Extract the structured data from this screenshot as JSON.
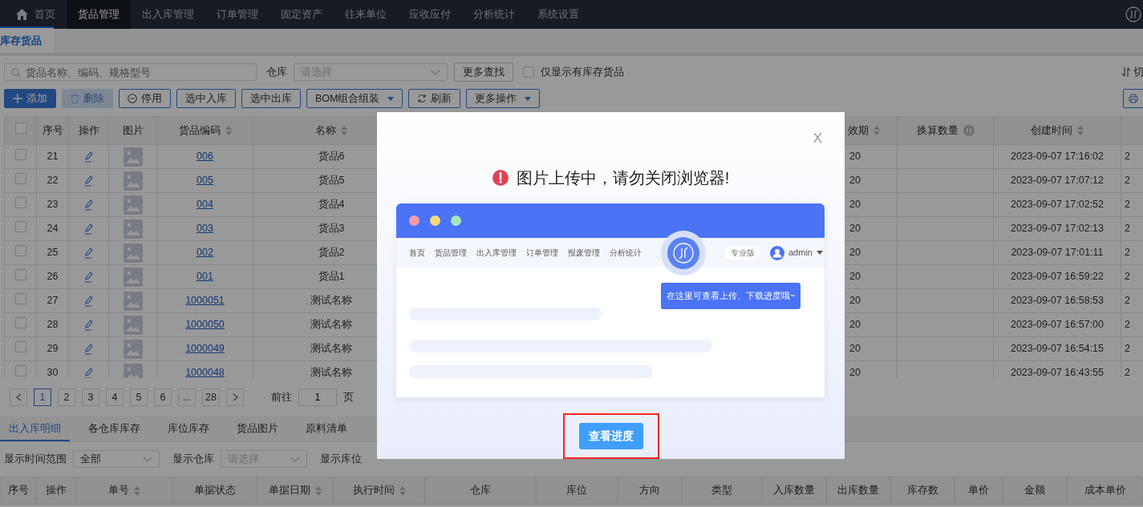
{
  "nav": {
    "items": [
      {
        "label": "首页",
        "selected": false,
        "kind": "home"
      },
      {
        "label": "货品管理",
        "selected": true,
        "kind": "text"
      },
      {
        "label": "出入库管理",
        "selected": false,
        "kind": "text"
      },
      {
        "label": "订单管理",
        "selected": false,
        "kind": "text"
      },
      {
        "label": "固定资产",
        "selected": false,
        "kind": "text"
      },
      {
        "label": "往来单位",
        "selected": false,
        "kind": "text"
      },
      {
        "label": "应收应付",
        "selected": false,
        "kind": "text"
      },
      {
        "label": "分析统计",
        "selected": false,
        "kind": "text"
      },
      {
        "label": "系统设置",
        "selected": false,
        "kind": "text"
      }
    ]
  },
  "page_tabs": [
    {
      "label": "库存货品",
      "selected": true
    }
  ],
  "filters": {
    "search": {
      "placeholder": "货品名称、编码、规格型号"
    },
    "warehouse_label": "仓库",
    "warehouse": {
      "placeholder": "请选择"
    },
    "more_search": "更多查找",
    "stock_only": {
      "label": "仅显示有库存货品",
      "checked": false
    },
    "switch_label": "切"
  },
  "toolbar": [
    {
      "label": "添加",
      "kind": "add",
      "disabled": false,
      "dropdown": false
    },
    {
      "label": "删除",
      "kind": "delete",
      "disabled": true,
      "dropdown": false
    },
    {
      "label": "停用",
      "kind": "disable",
      "disabled": false,
      "dropdown": false
    },
    {
      "label": "选中入库",
      "kind": "plain",
      "disabled": false,
      "dropdown": false
    },
    {
      "label": "选中出库",
      "kind": "plain",
      "disabled": false,
      "dropdown": false
    },
    {
      "label": "BOM组合组装",
      "kind": "plain",
      "disabled": false,
      "dropdown": true
    },
    {
      "label": "刷新",
      "kind": "refresh",
      "disabled": false,
      "dropdown": false
    },
    {
      "label": "更多操作",
      "kind": "plain",
      "disabled": false,
      "dropdown": true
    }
  ],
  "table": {
    "columns_left": [
      {
        "kind": "checkbox",
        "checked": false
      },
      {
        "kind": "text",
        "label": "序号",
        "sortable": false
      },
      {
        "kind": "text",
        "label": "操作",
        "sortable": false
      },
      {
        "kind": "text",
        "label": "图片",
        "sortable": false
      },
      {
        "kind": "text",
        "label": "货品编码",
        "sortable": true
      },
      {
        "kind": "text",
        "label": "名称",
        "sortable": true
      }
    ],
    "columns_right": [
      {
        "kind": "text",
        "label": "效期",
        "sortable": true
      },
      {
        "kind": "info",
        "label": "换算数量",
        "sortable": false
      },
      {
        "kind": "text",
        "label": "创建时间",
        "sortable": true
      },
      {
        "kind": "blank"
      }
    ],
    "rows": [
      {
        "checked": false,
        "no": "21",
        "code": "006",
        "name": "货品6",
        "expiry": "20",
        "created": "2023-09-07 17:16:02",
        "column_last": "2"
      },
      {
        "checked": false,
        "no": "22",
        "code": "005",
        "name": "货品5",
        "expiry": "20",
        "created": "2023-09-07 17:07:12",
        "column_last": "2"
      },
      {
        "checked": false,
        "no": "23",
        "code": "004",
        "name": "货品4",
        "expiry": "20",
        "created": "2023-09-07 17:02:52",
        "column_last": "2"
      },
      {
        "checked": false,
        "no": "24",
        "code": "003",
        "name": "货品3",
        "expiry": "20",
        "created": "2023-09-07 17:02:13",
        "column_last": "2"
      },
      {
        "checked": false,
        "no": "25",
        "code": "002",
        "name": "货品2",
        "expiry": "20",
        "created": "2023-09-07 17:01:11",
        "column_last": "2"
      },
      {
        "checked": false,
        "no": "26",
        "code": "001",
        "name": "货品1",
        "expiry": "20",
        "created": "2023-09-07 16:59:22",
        "column_last": "2"
      },
      {
        "checked": false,
        "no": "27",
        "code": "1000051",
        "name": "测试名称",
        "expiry": "20",
        "created": "2023-09-07 16:58:53",
        "column_last": "2"
      },
      {
        "checked": false,
        "no": "28",
        "code": "1000050",
        "name": "测试名称",
        "expiry": "20",
        "created": "2023-09-07 16:57:00",
        "column_last": "2"
      },
      {
        "checked": false,
        "no": "29",
        "code": "1000049",
        "name": "测试名称",
        "expiry": "20",
        "created": "2023-09-07 16:54:15",
        "column_last": "2"
      },
      {
        "checked": false,
        "no": "30",
        "code": "1000048",
        "name": "测试名称",
        "expiry": "20",
        "created": "2023-09-07 16:43:55",
        "column_last": "2"
      }
    ]
  },
  "pager": {
    "pages": [
      {
        "label": "1",
        "selected": true
      },
      {
        "label": "2",
        "selected": false
      },
      {
        "label": "3",
        "selected": false
      },
      {
        "label": "4",
        "selected": false
      },
      {
        "label": "5",
        "selected": false
      },
      {
        "label": "6",
        "selected": false
      },
      {
        "label": "...",
        "selected": false
      },
      {
        "label": "28",
        "selected": false
      }
    ],
    "goto_label": "前往",
    "goto_value": "1",
    "goto_suffix": "页"
  },
  "detail_tabs": [
    {
      "label": "出入库明细",
      "selected": true
    },
    {
      "label": "各仓库库存",
      "selected": false
    },
    {
      "label": "库位库存",
      "selected": false
    },
    {
      "label": "货品图片",
      "selected": false
    },
    {
      "label": "原料清单",
      "selected": false
    }
  ],
  "detail_filters": {
    "time_range_label": "显示时间范围",
    "time_range": {
      "value": "全部"
    },
    "warehouse_label": "显示仓库",
    "warehouse": {
      "placeholder": "请选择"
    },
    "location_label": "显示库位"
  },
  "detail_table": {
    "columns": [
      {
        "label": "序号",
        "sortable": false
      },
      {
        "label": "操作",
        "sortable": false
      },
      {
        "label": "单号",
        "sortable": true
      },
      {
        "label": "单据状态",
        "sortable": false
      },
      {
        "label": "单据日期",
        "sortable": true
      },
      {
        "label": "执行时间",
        "sortable": true
      },
      {
        "label": "仓库",
        "sortable": false
      },
      {
        "label": "库位",
        "sortable": false
      },
      {
        "label": "方向",
        "sortable": false
      },
      {
        "label": "类型",
        "sortable": false
      },
      {
        "label": "入库数量",
        "sortable": false
      },
      {
        "label": "出库数量",
        "sortable": false
      },
      {
        "label": "库存数",
        "sortable": false
      },
      {
        "label": "单价",
        "sortable": false
      },
      {
        "label": "金额",
        "sortable": false
      },
      {
        "label": "成本单价",
        "sortable": false
      }
    ]
  },
  "modal": {
    "close": "X",
    "title": "图片上传中，请勿关闭浏览器!",
    "illustration": {
      "nav_items": [
        "首页",
        "货品管理",
        "出入库管理",
        "订单管理",
        "报废管理",
        "分析统计"
      ],
      "edition": "专业版",
      "user": "admin",
      "tooltip": "在这里可查看上传、下载进度哦~"
    },
    "button": "查看进度"
  }
}
